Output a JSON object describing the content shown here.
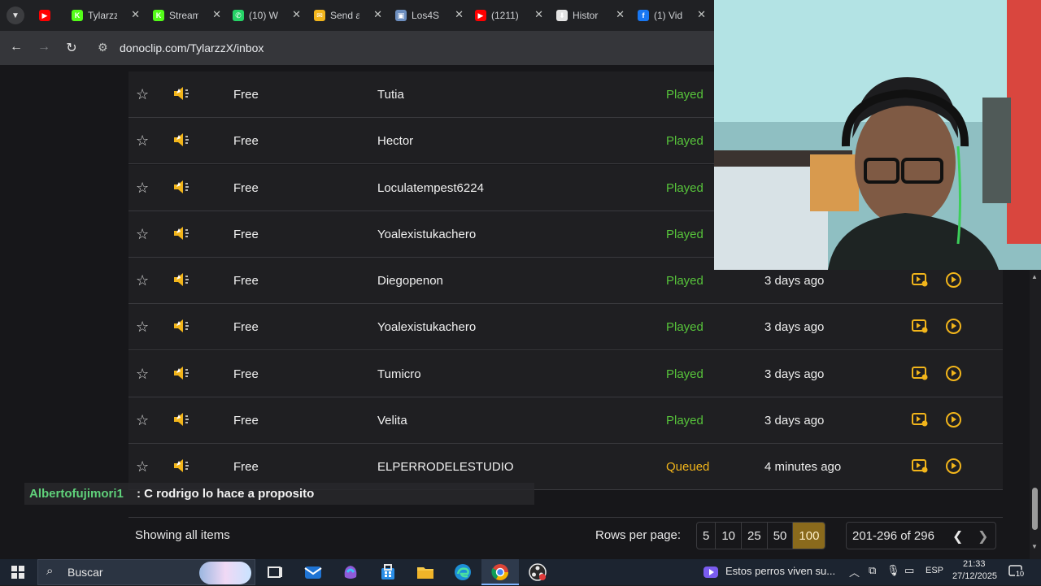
{
  "browser": {
    "tabs": [
      {
        "title": "",
        "favicon": "youtube-icon",
        "color": "#ff0000"
      },
      {
        "title": "Tylarzz",
        "favicon": "kick-icon",
        "color": "#53fc18"
      },
      {
        "title": "Stream",
        "favicon": "kick-icon",
        "color": "#53fc18"
      },
      {
        "title": "(10) W",
        "favicon": "whatsapp-icon",
        "color": "#25d366"
      },
      {
        "title": "Send a",
        "favicon": "send-icon",
        "color": "#f2b51b"
      },
      {
        "title": "Los4S",
        "favicon": "page-icon",
        "color": "#6c8ebf"
      },
      {
        "title": "(1211)",
        "favicon": "youtube-icon",
        "color": "#ff0000"
      },
      {
        "title": "Histor",
        "favicon": "download-icon",
        "color": "#e3e3e3"
      },
      {
        "title": "(1) Vid",
        "favicon": "facebook-icon",
        "color": "#1877f2"
      }
    ],
    "url": "donoclip.com/TylarzzX/inbox"
  },
  "table": {
    "rows": [
      {
        "amount": "Free",
        "user": "Tutia",
        "status": "Played",
        "time": ""
      },
      {
        "amount": "Free",
        "user": "Hector",
        "status": "Played",
        "time": ""
      },
      {
        "amount": "Free",
        "user": "Loculatempest6224",
        "status": "Played",
        "time": ""
      },
      {
        "amount": "Free",
        "user": "Yoalexistukachero",
        "status": "Played",
        "time": ""
      },
      {
        "amount": "Free",
        "user": "Diegopenon",
        "status": "Played",
        "time": "3 days ago"
      },
      {
        "amount": "Free",
        "user": "Yoalexistukachero",
        "status": "Played",
        "time": "3 days ago"
      },
      {
        "amount": "Free",
        "user": "Tumicro",
        "status": "Played",
        "time": "3 days ago"
      },
      {
        "amount": "Free",
        "user": "Velita",
        "status": "Played",
        "time": "3 days ago"
      },
      {
        "amount": "Free",
        "user": "ELPERRODELESTUDIO",
        "status": "Queued",
        "time": "4 minutes ago"
      }
    ]
  },
  "chat": {
    "username": "Albertofujimori1",
    "message": ": C rodrigo lo hace a proposito"
  },
  "footer": {
    "showing": "Showing all items",
    "rows_per_page_label": "Rows per page:",
    "rows_per_page_options": [
      "5",
      "10",
      "25",
      "50",
      "100"
    ],
    "rows_per_page_selected": "100",
    "range": "201-296 of 296"
  },
  "taskbar": {
    "search_placeholder": "Buscar",
    "media_title": "Estos perros viven su...",
    "language": "ESP",
    "time": "21:33",
    "date": "27/12/2025",
    "notification_count": "10"
  },
  "colors": {
    "played": "#57c43b",
    "queued": "#f2b51b",
    "accent": "#f2b51b"
  }
}
